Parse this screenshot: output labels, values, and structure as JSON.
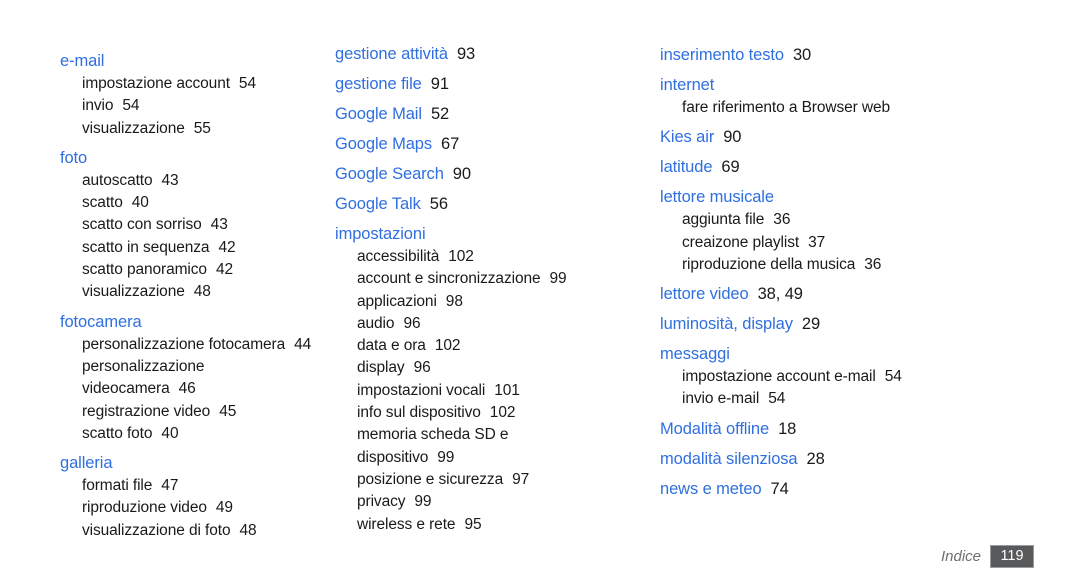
{
  "footer": {
    "label": "Indice",
    "page_number": "119"
  },
  "colors": {
    "heading": "#2f6fe0",
    "body": "#1a1a1a",
    "footer_label": "#6d6e71",
    "badge_bg": "#58595b",
    "badge_border": "#9a9b9d",
    "badge_text": "#ffffff",
    "background": "#ffffff"
  },
  "columns": [
    {
      "id": "column-1",
      "entries": [
        {
          "term": "e-mail",
          "pages": "",
          "subs": [
            {
              "term": "impostazione account",
              "pages": "54"
            },
            {
              "term": "invio",
              "pages": "54"
            },
            {
              "term": "visualizzazione",
              "pages": "55"
            }
          ]
        },
        {
          "term": "foto",
          "pages": "",
          "subs": [
            {
              "term": "autoscatto",
              "pages": "43"
            },
            {
              "term": "scatto",
              "pages": "40"
            },
            {
              "term": "scatto con sorriso",
              "pages": "43"
            },
            {
              "term": "scatto in sequenza",
              "pages": "42"
            },
            {
              "term": "scatto panoramico",
              "pages": "42"
            },
            {
              "term": "visualizzazione",
              "pages": "48"
            }
          ]
        },
        {
          "term": "fotocamera",
          "pages": "",
          "subs": [
            {
              "term": "personalizzazione fotocamera",
              "pages": "44"
            },
            {
              "term": "personalizzazione",
              "pages": ""
            },
            {
              "term": "videocamera",
              "pages": "46"
            },
            {
              "term": "registrazione video",
              "pages": "45"
            },
            {
              "term": "scatto foto",
              "pages": "40"
            }
          ]
        },
        {
          "term": "galleria",
          "pages": "",
          "subs": [
            {
              "term": "formati file",
              "pages": "47"
            },
            {
              "term": "riproduzione video",
              "pages": "49"
            },
            {
              "term": "visualizzazione di foto",
              "pages": "48"
            }
          ]
        }
      ]
    },
    {
      "id": "column-2",
      "entries": [
        {
          "term": "gestione attività",
          "pages": "93",
          "subs": []
        },
        {
          "term": "gestione file",
          "pages": "91",
          "subs": []
        },
        {
          "term": "Google Mail",
          "pages": "52",
          "subs": []
        },
        {
          "term": "Google Maps",
          "pages": "67",
          "subs": []
        },
        {
          "term": "Google Search",
          "pages": "90",
          "subs": []
        },
        {
          "term": "Google Talk",
          "pages": "56",
          "subs": []
        },
        {
          "term": "impostazioni",
          "pages": "",
          "subs": [
            {
              "term": "accessibilità",
              "pages": "102"
            },
            {
              "term": "account e sincronizzazione",
              "pages": "99"
            },
            {
              "term": "applicazioni",
              "pages": "98"
            },
            {
              "term": "audio",
              "pages": "96"
            },
            {
              "term": "data e ora",
              "pages": "102"
            },
            {
              "term": "display",
              "pages": "96"
            },
            {
              "term": "impostazioni vocali",
              "pages": "101"
            },
            {
              "term": "info sul dispositivo",
              "pages": "102"
            },
            {
              "term": "memoria scheda SD e",
              "pages": ""
            },
            {
              "term": "dispositivo",
              "pages": "99"
            },
            {
              "term": "posizione e sicurezza",
              "pages": "97"
            },
            {
              "term": "privacy",
              "pages": "99"
            },
            {
              "term": "wireless e rete",
              "pages": "95"
            }
          ]
        }
      ]
    },
    {
      "id": "column-3",
      "entries": [
        {
          "term": "inserimento testo",
          "pages": "30",
          "subs": []
        },
        {
          "term": "internet",
          "pages": "",
          "subs": [
            {
              "term": "fare riferimento a Browser web",
              "pages": ""
            }
          ]
        },
        {
          "term": "Kies air",
          "pages": "90",
          "subs": []
        },
        {
          "term": "latitude",
          "pages": "69",
          "subs": []
        },
        {
          "term": "lettore musicale",
          "pages": "",
          "subs": [
            {
              "term": "aggiunta file",
              "pages": "36"
            },
            {
              "term": "creaizone playlist",
              "pages": "37"
            },
            {
              "term": "riproduzione della musica",
              "pages": "36"
            }
          ]
        },
        {
          "term": "lettore video",
          "pages": "38, 49",
          "subs": []
        },
        {
          "term": "luminosità, display",
          "pages": "29",
          "subs": []
        },
        {
          "term": "messaggi",
          "pages": "",
          "subs": [
            {
              "term": "impostazione account e-mail",
              "pages": "54"
            },
            {
              "term": "invio e-mail",
              "pages": "54"
            }
          ]
        },
        {
          "term": "Modalità offline",
          "pages": "18",
          "subs": []
        },
        {
          "term": "modalità silenziosa",
          "pages": "28",
          "subs": []
        },
        {
          "term": "news e meteo",
          "pages": "74",
          "subs": []
        }
      ]
    }
  ]
}
